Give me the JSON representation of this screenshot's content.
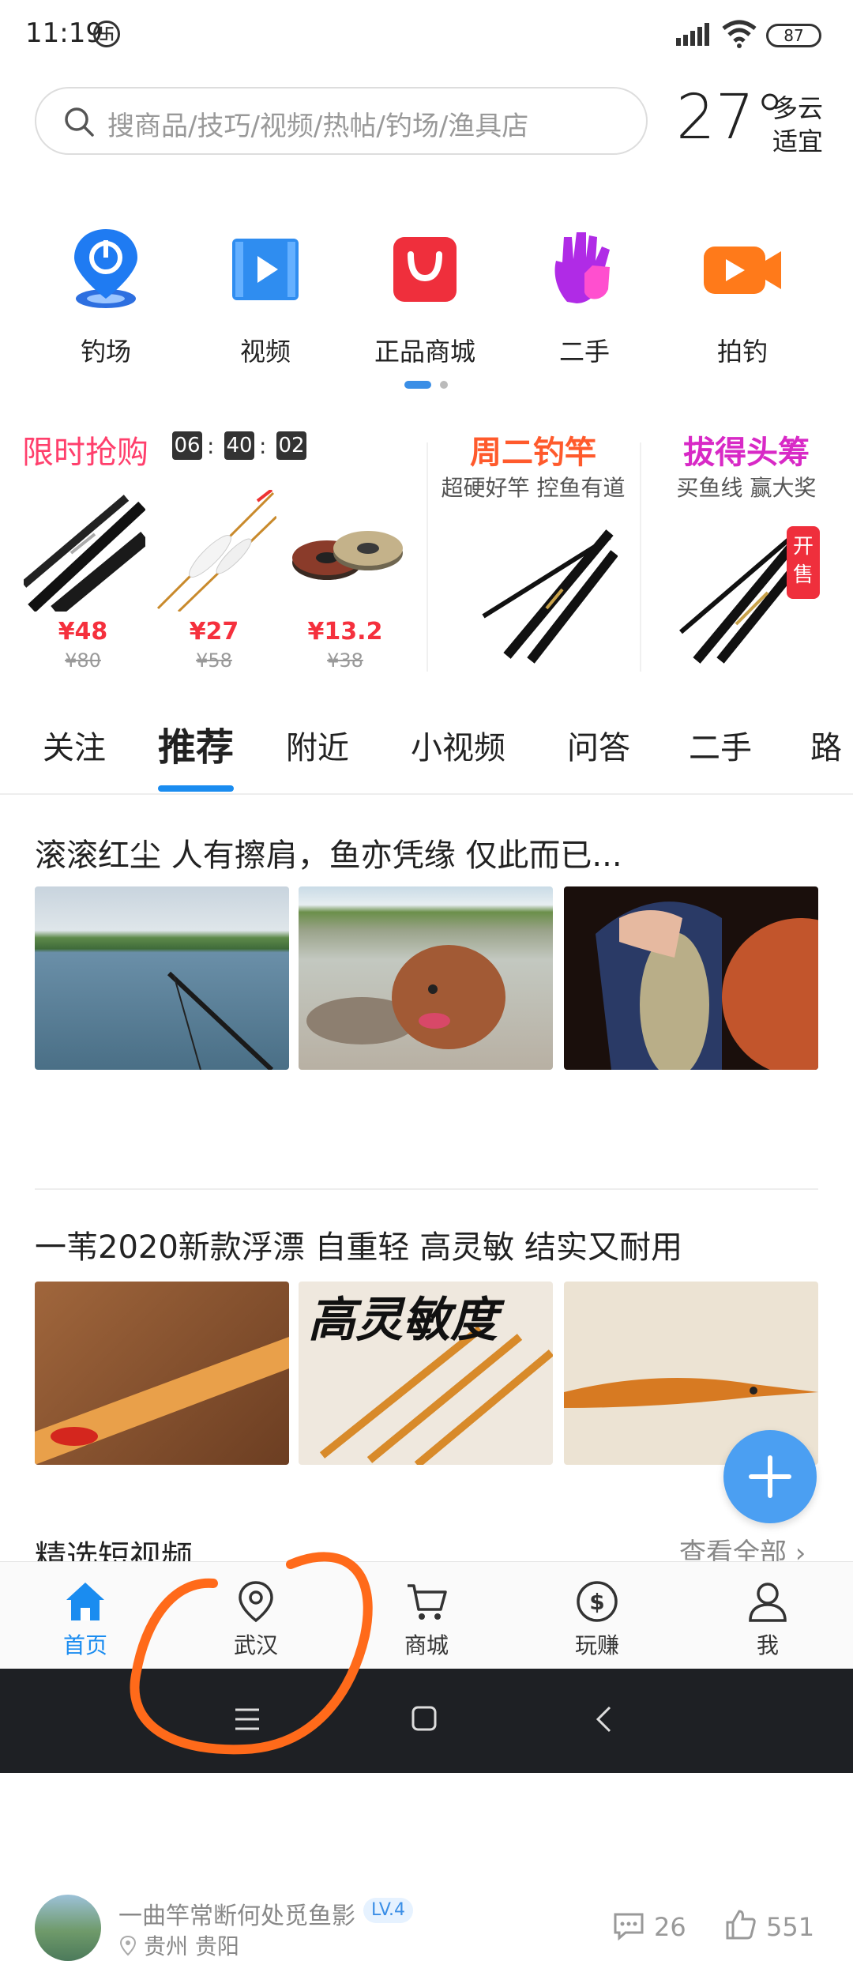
{
  "status_bar": {
    "time": "11:19",
    "net_glyph": "卐",
    "battery": "87"
  },
  "search": {
    "placeholder": "搜商品/技巧/视频/热帖/钓场/渔具店"
  },
  "weather": {
    "temp": "27°",
    "cond": "多云",
    "advice": "适宜"
  },
  "categories": [
    {
      "label": "钓场",
      "icon": "location-pin-icon"
    },
    {
      "label": "视频",
      "icon": "video-icon"
    },
    {
      "label": "正品商城",
      "icon": "shopping-bag-icon"
    },
    {
      "label": "二手",
      "icon": "hand-icon"
    },
    {
      "label": "拍钓",
      "icon": "camera-icon"
    }
  ],
  "flash_sale": {
    "title": "限时抢购",
    "countdown": [
      "06",
      "40",
      "02"
    ],
    "colon": ":",
    "items": [
      {
        "price": "¥48",
        "old_price": "¥80"
      },
      {
        "price": "¥27",
        "old_price": "¥58"
      },
      {
        "price": "¥13.2",
        "old_price": "¥38"
      }
    ]
  },
  "promos": [
    {
      "title": "周二钓竿",
      "subtitle": "超硬好竿 控鱼有道",
      "color": "#ff5a2c"
    },
    {
      "title": "拔得头筹",
      "subtitle": "买鱼线 赢大奖",
      "color": "#d829c6",
      "badge": "开售"
    }
  ],
  "tabs": [
    "关注",
    "推荐",
    "附近",
    "小视频",
    "问答",
    "二手",
    "路"
  ],
  "active_tab": "推荐",
  "posts": [
    {
      "title": "滚滚红尘 人有擦肩，鱼亦凭缘 仅此而已...",
      "author": "一曲竿常断何处觅鱼影",
      "level": "LV.4",
      "location": "贵州 贵阳",
      "comments": "26",
      "likes": "551"
    },
    {
      "title": "一苇2020新款浮漂 自重轻 高灵敏 结实又耐用",
      "image_caption": "高灵敏度"
    }
  ],
  "section": {
    "title": "精选短视频",
    "more": "查看全部"
  },
  "bottom_nav": [
    {
      "label": "首页",
      "icon": "home-icon",
      "active": true
    },
    {
      "label": "武汉",
      "icon": "location-icon"
    },
    {
      "label": "商城",
      "icon": "cart-icon"
    },
    {
      "label": "玩赚",
      "icon": "coin-icon"
    },
    {
      "label": "我",
      "icon": "user-icon"
    }
  ],
  "colors": {
    "accent": "#1a8cf0",
    "price": "#f5303d",
    "flash_title": "#ff3f6c",
    "annotation": "#ff6a1a"
  }
}
